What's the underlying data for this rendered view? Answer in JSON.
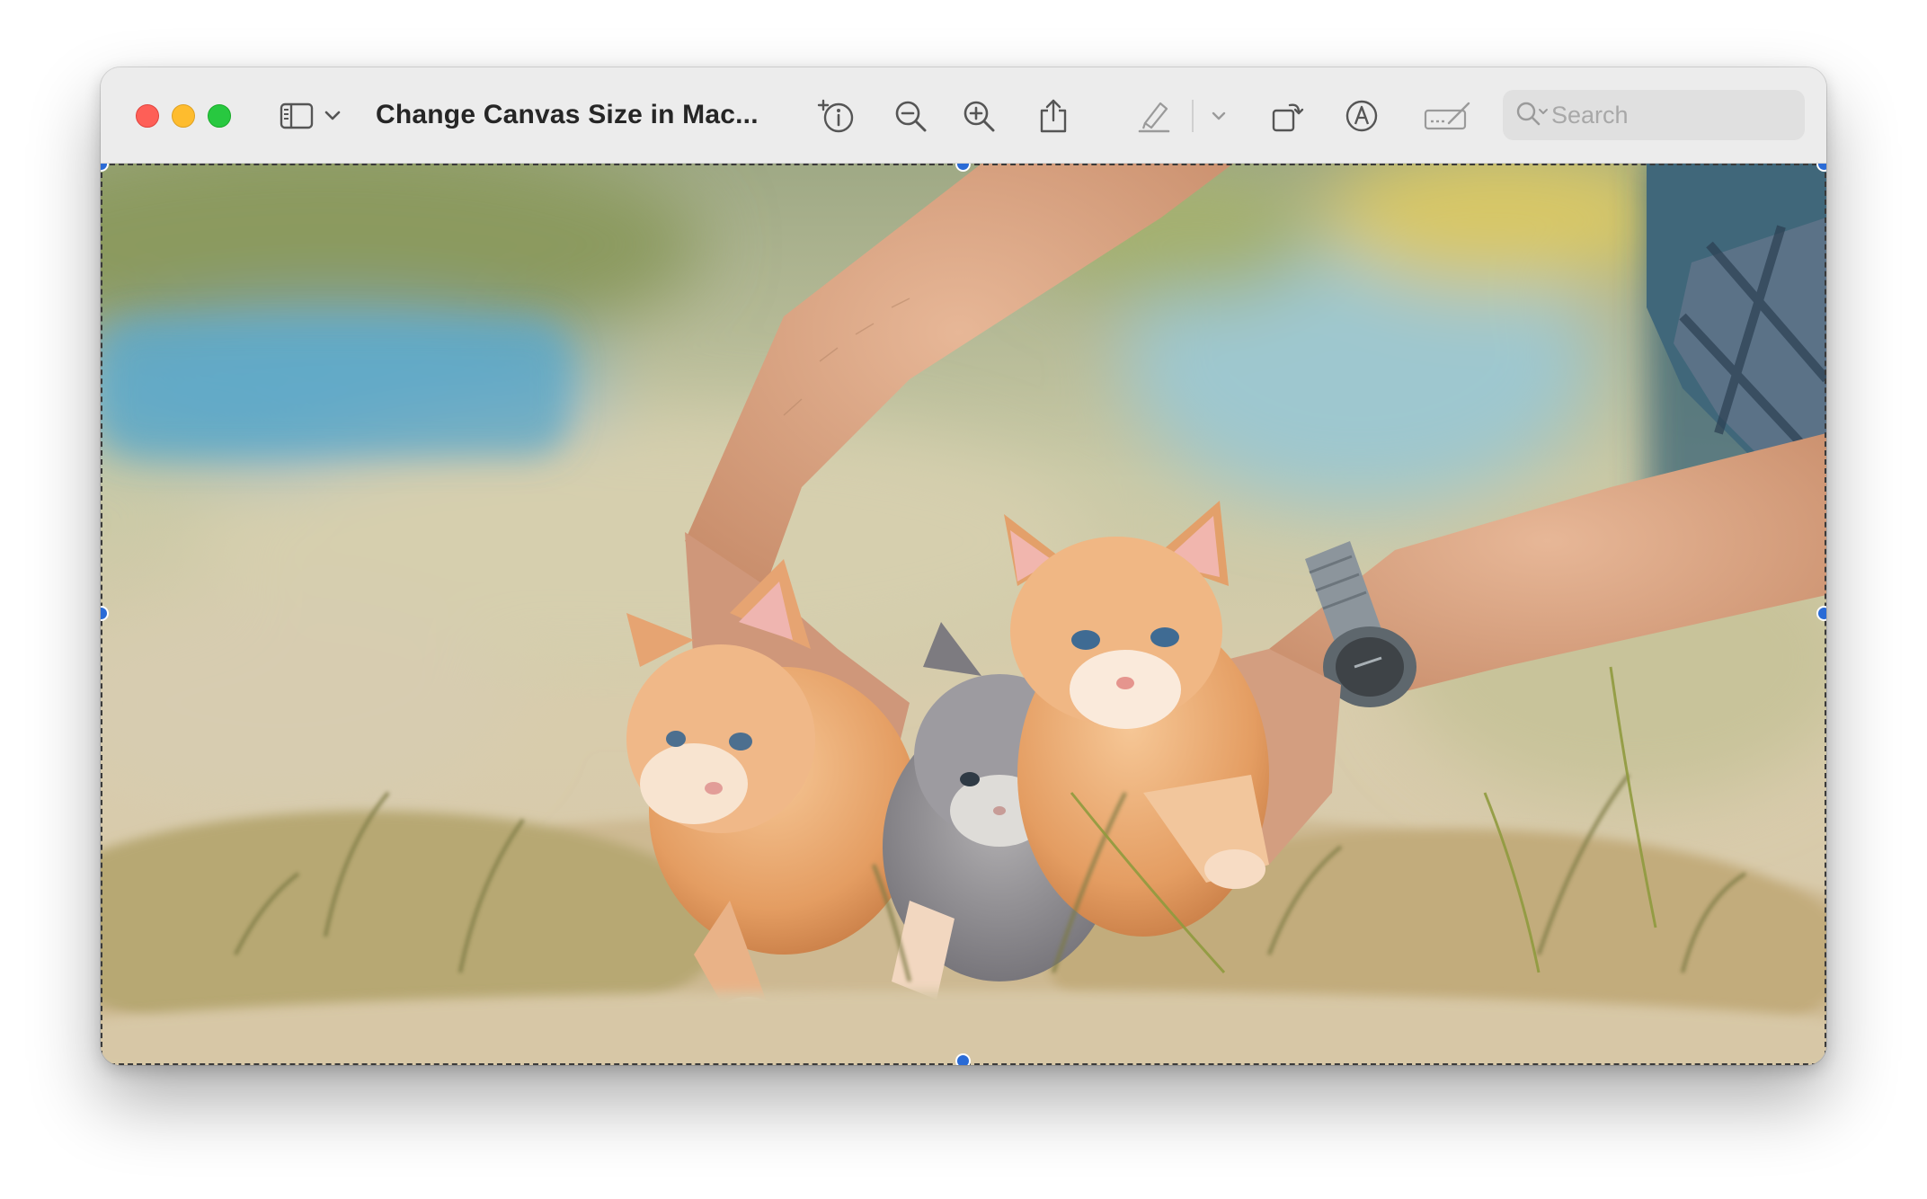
{
  "window": {
    "title": "Change Canvas Size in Mac..."
  },
  "toolbar": {
    "sidebar_toggle_icon": "sidebar-icon",
    "sidebar_menu_icon": "chevron-down-icon",
    "inspector_icon": "info-icon",
    "zoom_out_icon": "zoom-out-icon",
    "zoom_in_icon": "zoom-in-icon",
    "share_icon": "share-icon",
    "highlight_icon": "highlighter-icon",
    "highlight_menu_icon": "chevron-down-icon",
    "rotate_icon": "rotate-icon",
    "markup_icon": "markup-icon",
    "sign_icon": "signature-icon"
  },
  "search": {
    "placeholder": "Search"
  },
  "image": {
    "description_icon": "photo-kittens",
    "colors": {
      "fur_orange": "#e8a46a",
      "fur_gray": "#8e8e94",
      "grass": "#c9b98a",
      "selection_handle": "#2a6bd6"
    }
  }
}
